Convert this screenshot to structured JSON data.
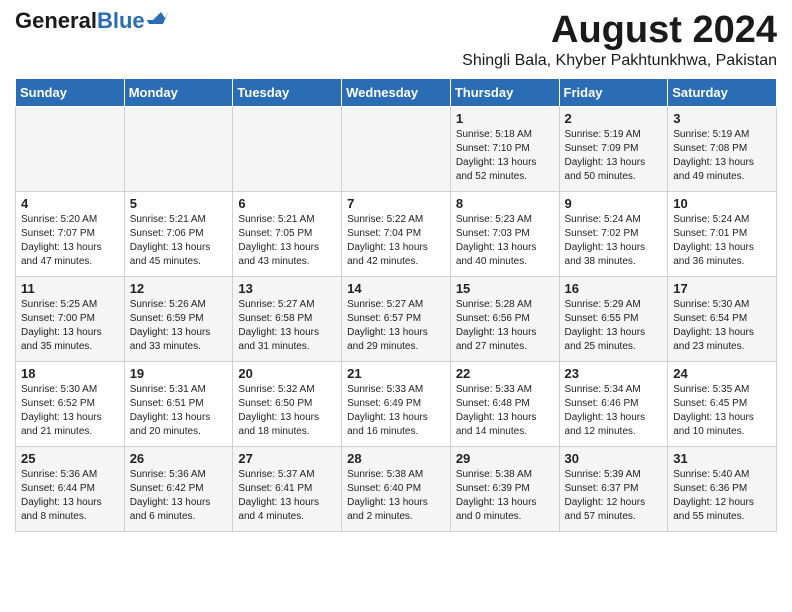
{
  "header": {
    "logo_general": "General",
    "logo_blue": "Blue",
    "month_year": "August 2024",
    "location": "Shingli Bala, Khyber Pakhtunkhwa, Pakistan"
  },
  "weekdays": [
    "Sunday",
    "Monday",
    "Tuesday",
    "Wednesday",
    "Thursday",
    "Friday",
    "Saturday"
  ],
  "weeks": [
    [
      {
        "day": "",
        "detail": ""
      },
      {
        "day": "",
        "detail": ""
      },
      {
        "day": "",
        "detail": ""
      },
      {
        "day": "",
        "detail": ""
      },
      {
        "day": "1",
        "detail": "Sunrise: 5:18 AM\nSunset: 7:10 PM\nDaylight: 13 hours\nand 52 minutes."
      },
      {
        "day": "2",
        "detail": "Sunrise: 5:19 AM\nSunset: 7:09 PM\nDaylight: 13 hours\nand 50 minutes."
      },
      {
        "day": "3",
        "detail": "Sunrise: 5:19 AM\nSunset: 7:08 PM\nDaylight: 13 hours\nand 49 minutes."
      }
    ],
    [
      {
        "day": "4",
        "detail": "Sunrise: 5:20 AM\nSunset: 7:07 PM\nDaylight: 13 hours\nand 47 minutes."
      },
      {
        "day": "5",
        "detail": "Sunrise: 5:21 AM\nSunset: 7:06 PM\nDaylight: 13 hours\nand 45 minutes."
      },
      {
        "day": "6",
        "detail": "Sunrise: 5:21 AM\nSunset: 7:05 PM\nDaylight: 13 hours\nand 43 minutes."
      },
      {
        "day": "7",
        "detail": "Sunrise: 5:22 AM\nSunset: 7:04 PM\nDaylight: 13 hours\nand 42 minutes."
      },
      {
        "day": "8",
        "detail": "Sunrise: 5:23 AM\nSunset: 7:03 PM\nDaylight: 13 hours\nand 40 minutes."
      },
      {
        "day": "9",
        "detail": "Sunrise: 5:24 AM\nSunset: 7:02 PM\nDaylight: 13 hours\nand 38 minutes."
      },
      {
        "day": "10",
        "detail": "Sunrise: 5:24 AM\nSunset: 7:01 PM\nDaylight: 13 hours\nand 36 minutes."
      }
    ],
    [
      {
        "day": "11",
        "detail": "Sunrise: 5:25 AM\nSunset: 7:00 PM\nDaylight: 13 hours\nand 35 minutes."
      },
      {
        "day": "12",
        "detail": "Sunrise: 5:26 AM\nSunset: 6:59 PM\nDaylight: 13 hours\nand 33 minutes."
      },
      {
        "day": "13",
        "detail": "Sunrise: 5:27 AM\nSunset: 6:58 PM\nDaylight: 13 hours\nand 31 minutes."
      },
      {
        "day": "14",
        "detail": "Sunrise: 5:27 AM\nSunset: 6:57 PM\nDaylight: 13 hours\nand 29 minutes."
      },
      {
        "day": "15",
        "detail": "Sunrise: 5:28 AM\nSunset: 6:56 PM\nDaylight: 13 hours\nand 27 minutes."
      },
      {
        "day": "16",
        "detail": "Sunrise: 5:29 AM\nSunset: 6:55 PM\nDaylight: 13 hours\nand 25 minutes."
      },
      {
        "day": "17",
        "detail": "Sunrise: 5:30 AM\nSunset: 6:54 PM\nDaylight: 13 hours\nand 23 minutes."
      }
    ],
    [
      {
        "day": "18",
        "detail": "Sunrise: 5:30 AM\nSunset: 6:52 PM\nDaylight: 13 hours\nand 21 minutes."
      },
      {
        "day": "19",
        "detail": "Sunrise: 5:31 AM\nSunset: 6:51 PM\nDaylight: 13 hours\nand 20 minutes."
      },
      {
        "day": "20",
        "detail": "Sunrise: 5:32 AM\nSunset: 6:50 PM\nDaylight: 13 hours\nand 18 minutes."
      },
      {
        "day": "21",
        "detail": "Sunrise: 5:33 AM\nSunset: 6:49 PM\nDaylight: 13 hours\nand 16 minutes."
      },
      {
        "day": "22",
        "detail": "Sunrise: 5:33 AM\nSunset: 6:48 PM\nDaylight: 13 hours\nand 14 minutes."
      },
      {
        "day": "23",
        "detail": "Sunrise: 5:34 AM\nSunset: 6:46 PM\nDaylight: 13 hours\nand 12 minutes."
      },
      {
        "day": "24",
        "detail": "Sunrise: 5:35 AM\nSunset: 6:45 PM\nDaylight: 13 hours\nand 10 minutes."
      }
    ],
    [
      {
        "day": "25",
        "detail": "Sunrise: 5:36 AM\nSunset: 6:44 PM\nDaylight: 13 hours\nand 8 minutes."
      },
      {
        "day": "26",
        "detail": "Sunrise: 5:36 AM\nSunset: 6:42 PM\nDaylight: 13 hours\nand 6 minutes."
      },
      {
        "day": "27",
        "detail": "Sunrise: 5:37 AM\nSunset: 6:41 PM\nDaylight: 13 hours\nand 4 minutes."
      },
      {
        "day": "28",
        "detail": "Sunrise: 5:38 AM\nSunset: 6:40 PM\nDaylight: 13 hours\nand 2 minutes."
      },
      {
        "day": "29",
        "detail": "Sunrise: 5:38 AM\nSunset: 6:39 PM\nDaylight: 13 hours\nand 0 minutes."
      },
      {
        "day": "30",
        "detail": "Sunrise: 5:39 AM\nSunset: 6:37 PM\nDaylight: 12 hours\nand 57 minutes."
      },
      {
        "day": "31",
        "detail": "Sunrise: 5:40 AM\nSunset: 6:36 PM\nDaylight: 12 hours\nand 55 minutes."
      }
    ]
  ]
}
